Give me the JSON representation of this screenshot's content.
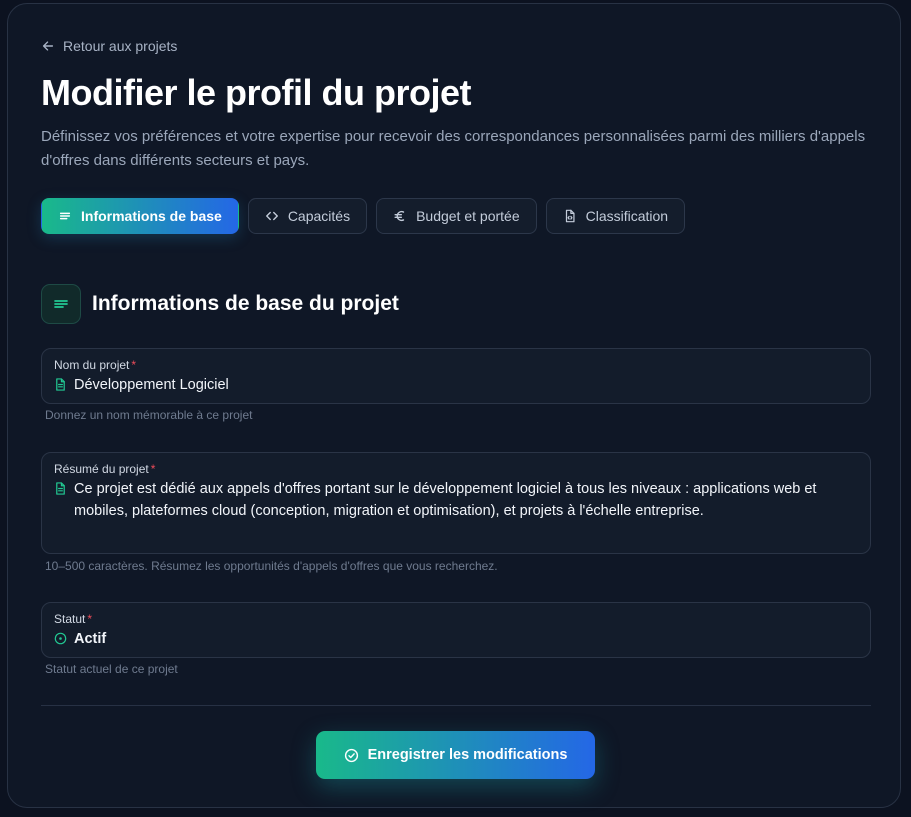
{
  "back_link": {
    "label": "Retour aux projets",
    "icon": "arrow-left-icon"
  },
  "page_title": "Modifier le profil du projet",
  "subtitle": "Définissez vos préférences et votre expertise pour recevoir des correspondances personnalisées parmi des milliers d'appels d'offres dans différents secteurs et pays.",
  "tabs": [
    {
      "label": "Informations de base",
      "icon": "lines-icon",
      "active": true
    },
    {
      "label": "Capacités",
      "icon": "code-icon",
      "active": false
    },
    {
      "label": "Budget et portée",
      "icon": "euro-icon",
      "active": false
    },
    {
      "label": "Classification",
      "icon": "file-code-icon",
      "active": false
    }
  ],
  "section": {
    "title": "Informations de base du projet",
    "icon": "lines-icon"
  },
  "fields": {
    "name": {
      "label": "Nom du projet",
      "required_mark": "*",
      "value": "Développement Logiciel",
      "helper": "Donnez un nom mémorable à ce projet",
      "icon": "document-icon"
    },
    "summary": {
      "label": "Résumé du projet",
      "required_mark": "*",
      "value": "Ce projet est dédié aux appels d'offres portant sur le développement logiciel à tous les niveaux : applications web et mobiles, plateformes cloud (conception, migration et optimisation), et projets à l'échelle entreprise.",
      "helper": "10–500 caractères. Résumez les opportunités d'appels d'offres que vous recherchez.",
      "icon": "document-icon"
    },
    "status": {
      "label": "Statut",
      "required_mark": "*",
      "value": "Actif",
      "helper": "Statut actuel de ce projet",
      "icon": "circle-dot-icon"
    }
  },
  "save_button": {
    "label": "Enregistrer les modifications",
    "icon": "check-circle-icon"
  },
  "colors": {
    "background": "#0c1220",
    "card": "#0f1726",
    "accent_start": "#19b98a",
    "accent_end": "#2467e6",
    "required": "#ef4c5a",
    "icon_green": "#22c993"
  }
}
